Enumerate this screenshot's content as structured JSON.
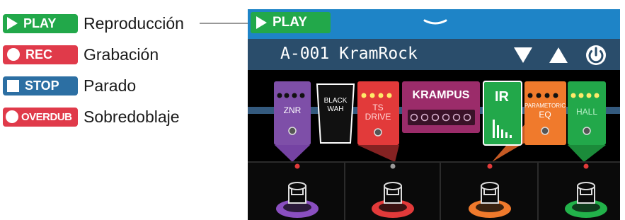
{
  "legend": {
    "play": {
      "badge": "PLAY",
      "label": "Reproducción",
      "color": "#22a84a"
    },
    "rec": {
      "badge": "REC",
      "label": "Grabación",
      "color": "#e03a4a"
    },
    "stop": {
      "badge": "STOP",
      "label": "Parado",
      "color": "#2c6fa3"
    },
    "overdub": {
      "badge": "OVERDUB",
      "label": "Sobredoblaje",
      "color": "#e03a4a"
    }
  },
  "screen": {
    "state_badge": "PLAY",
    "topbar_color": "#1e84c7",
    "patch_name": "A-001 KramRock",
    "controls": [
      "triangle-down-icon",
      "triangle-up-icon",
      "power-icon"
    ]
  },
  "effects": [
    {
      "name": "ZNR",
      "color": "#7e4fa8"
    },
    {
      "name_lines": [
        "BLACK",
        "WAH"
      ],
      "color": "#111111"
    },
    {
      "name_lines": [
        "TS",
        "DRIVE"
      ],
      "color": "#e23a3a"
    },
    {
      "name": "KRAMPUS",
      "color": "#9b2c6a"
    },
    {
      "name": "IR",
      "color": "#22a84a"
    },
    {
      "name_lines": [
        "PARAMETORIC",
        "EQ"
      ],
      "color": "#f07a2c"
    },
    {
      "name": "HALL",
      "color": "#22a84a"
    }
  ],
  "footswitch_colors": [
    "#8a4fc0",
    "#e23a3a",
    "#f07a2c",
    "#22b24a"
  ]
}
